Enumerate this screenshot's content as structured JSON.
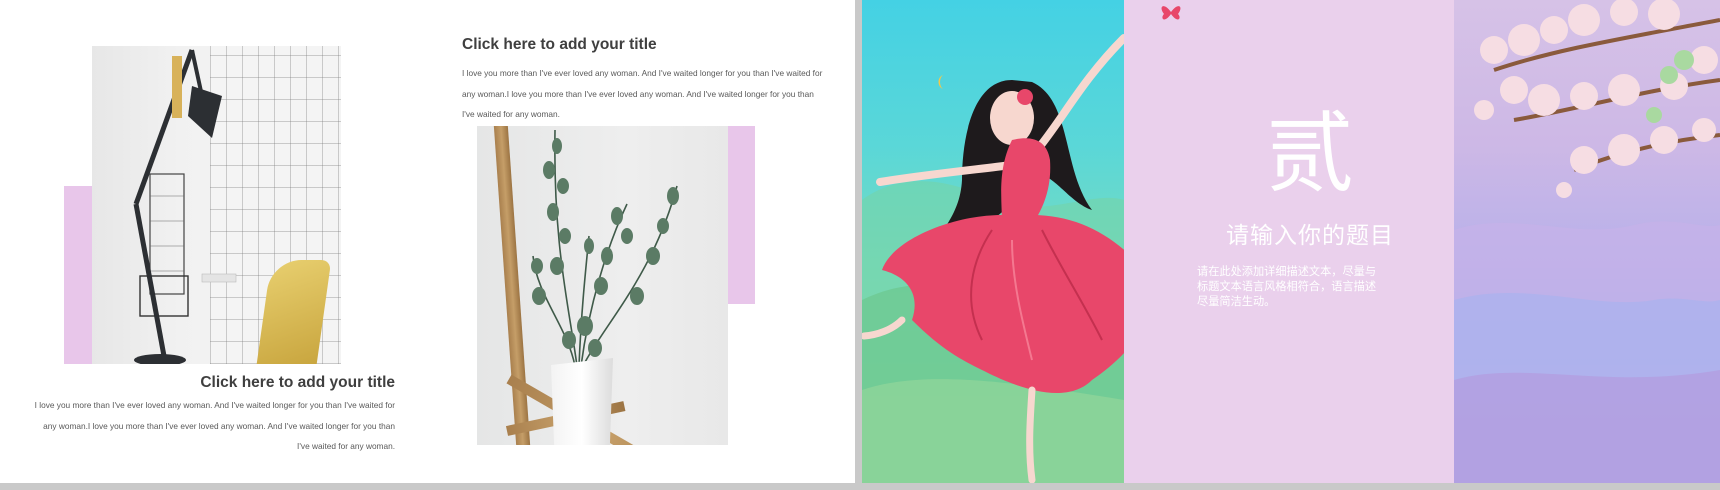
{
  "left_slide": {
    "top_text": {
      "title": "Click here to add your title",
      "lines": [
        "I love you more than I've ever loved any woman. And I've waited longer for you than I've waited for",
        "any woman.I love you more than I've ever loved any woman. And I've waited longer for you than",
        "I've waited for any woman."
      ]
    },
    "bottom_text": {
      "title": "Click here to add your title",
      "lines": [
        "I love you more than I've ever loved any woman. And I've waited longer for you than I've waited for",
        "any woman.I love you more than I've ever loved any woman. And I've waited longer for you than",
        "I've waited for any woman."
      ]
    }
  },
  "right_slide": {
    "number_char": "贰",
    "title": "请输入你的题目",
    "body_lines": [
      "请在此处添加详细描述文本，尽量与",
      "标题文本语言风格相符合，语言描述",
      "尽量简洁生动。"
    ]
  },
  "colors": {
    "accent_pink": "#e8c6ea",
    "right_panel": "#ead0ec",
    "title_text": "#3f3f3f",
    "body_text": "#595959",
    "dress": "#e8476a"
  },
  "icons": [
    "butterfly-icon",
    "moon-icon"
  ]
}
